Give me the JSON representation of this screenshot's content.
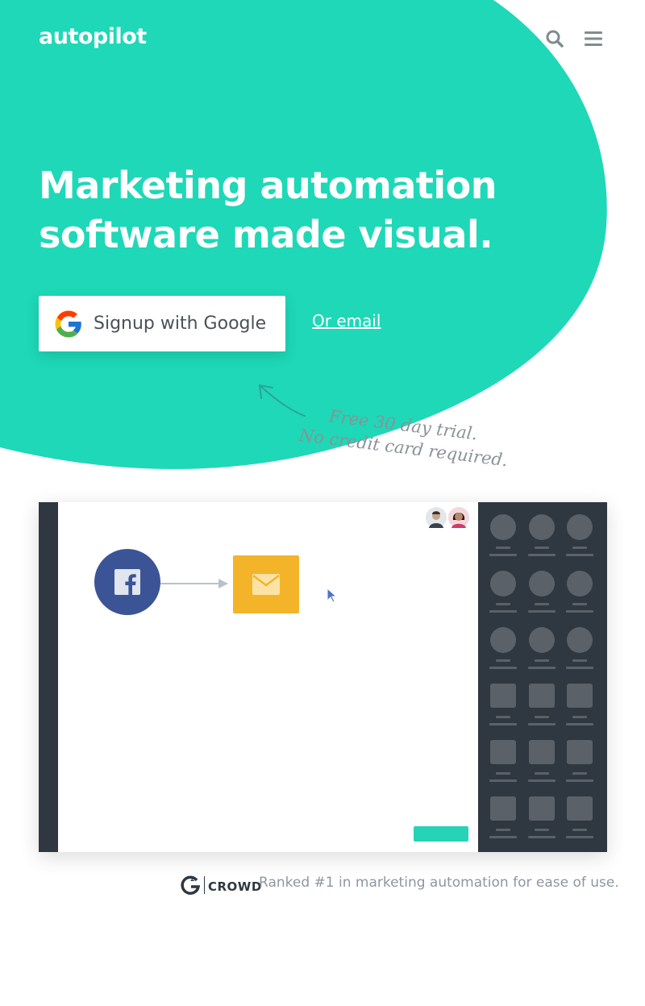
{
  "header": {
    "logo_text": "autopilot",
    "search_icon": "search-icon",
    "menu_icon": "hamburger-menu-icon"
  },
  "hero": {
    "title_line1": "Marketing automation",
    "title_line2": "software made visual.",
    "google_button_label": "Signup with Google",
    "google_icon": "google-g-icon",
    "email_link": "Or email",
    "trial_line1": "Free 30 day trial.",
    "trial_line2": "No credit card required."
  },
  "app_preview": {
    "avatars": [
      "male-avatar",
      "female-avatar"
    ],
    "nodes": [
      {
        "type": "trigger",
        "icon": "facebook-icon"
      },
      {
        "type": "action",
        "icon": "envelope-icon"
      }
    ]
  },
  "footer": {
    "badge_text": "CROWD",
    "rank_text": "Ranked #1 in marketing automation for ease of use."
  },
  "colors": {
    "brand_teal": "#1ed8b7",
    "dark_panel": "#2f3740",
    "facebook_blue": "#3b5495",
    "email_yellow": "#f4b42a",
    "muted_text": "#8e96a0"
  }
}
